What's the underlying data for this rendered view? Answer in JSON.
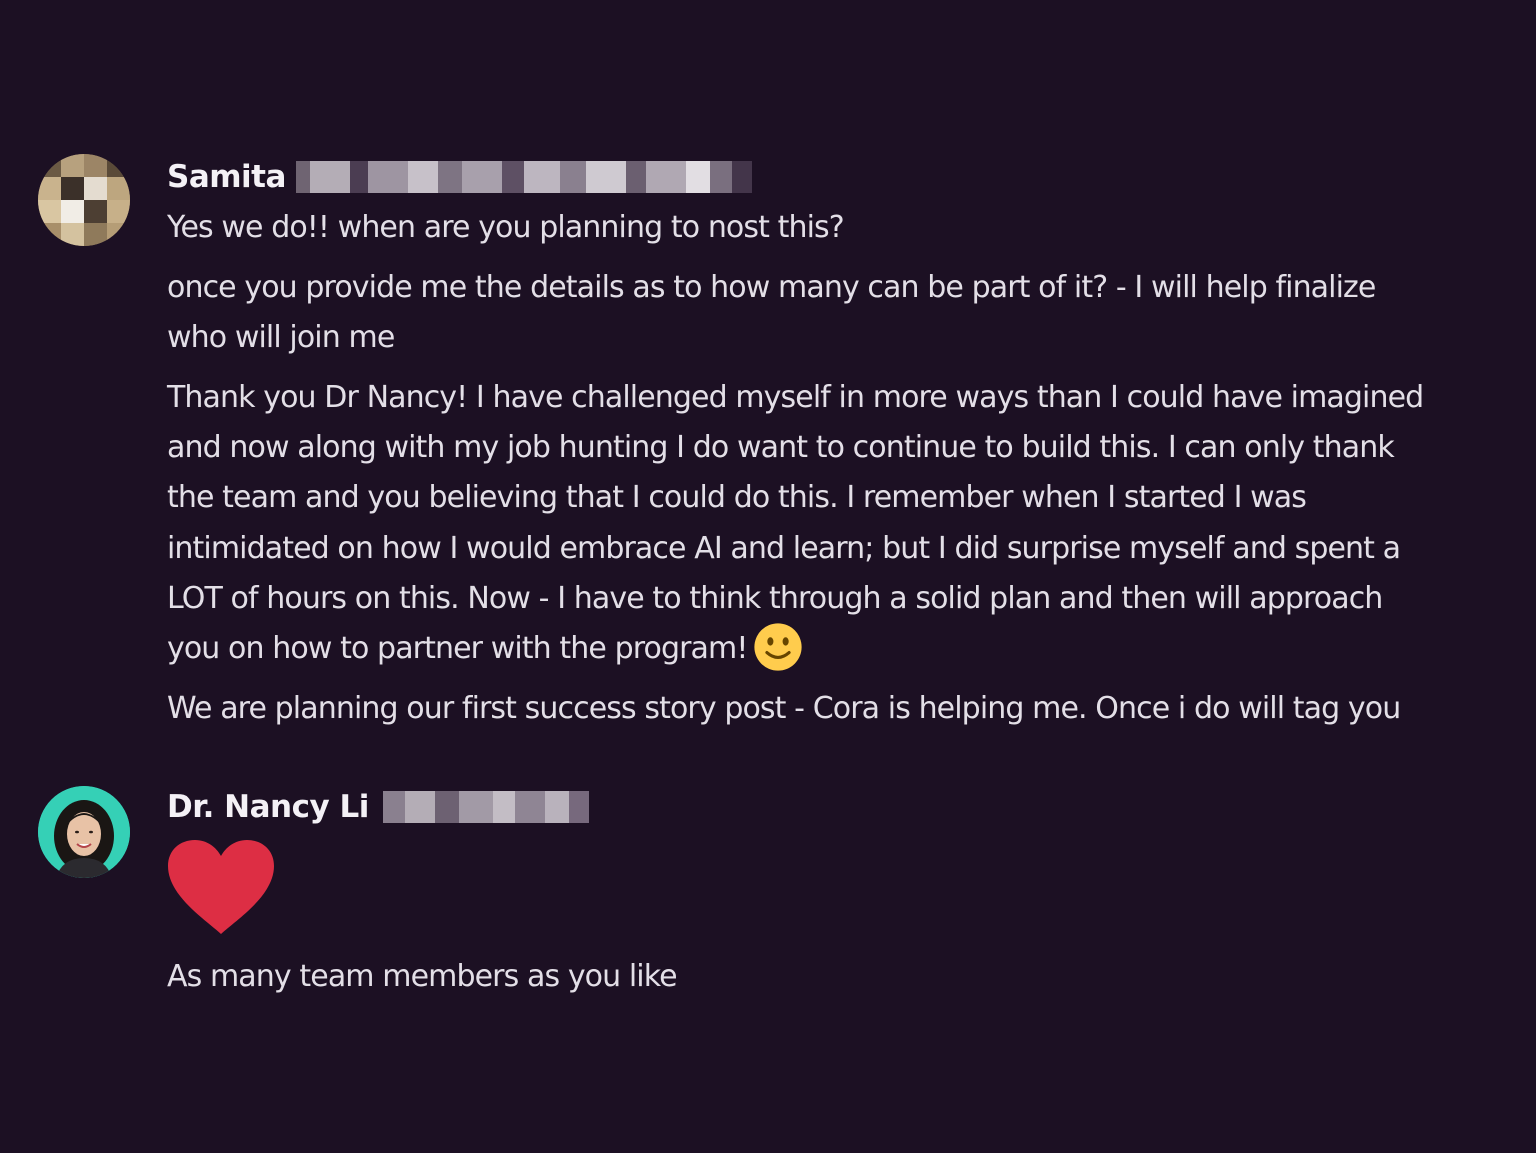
{
  "colors": {
    "background": "#1c1023",
    "text": "#e3dfe7",
    "author": "#f4f1f6",
    "heart": "#dd2e44",
    "emoji_face": "#ffcc4d",
    "avatar_ring": "#35d0b6"
  },
  "messages": [
    {
      "author": "Samita",
      "avatar_icon": "user-avatar-pixelated",
      "lines": [
        [
          "Yes we do!! when are you planning to nost this?"
        ],
        [
          "once you provide me the details as to how many can be part of it? - I will help finalize",
          "who will join me"
        ],
        [
          "Thank you Dr Nancy! I have challenged myself in more ways than I could have imagined",
          "and now along with my job hunting I do want to continue to build this.  I can only thank",
          "the team and you believing that I could do this.  I remember when I started I was",
          "intimidated on how I would embrace AI and learn; but I did surprise myself and spent a",
          "LOT of hours on this. Now -  I have to think through a solid plan and then will approach",
          "you on how to partner with the program!"
        ],
        [
          "We are planning our first success story post - Cora is helping me.  Once i do will tag you"
        ]
      ],
      "emoji": "slightly-smiling-face-icon"
    },
    {
      "author": "Dr. Nancy Li",
      "avatar_icon": "user-avatar-photo",
      "reaction_icon": "red-heart-icon",
      "text": "As many team members as you like"
    }
  ]
}
